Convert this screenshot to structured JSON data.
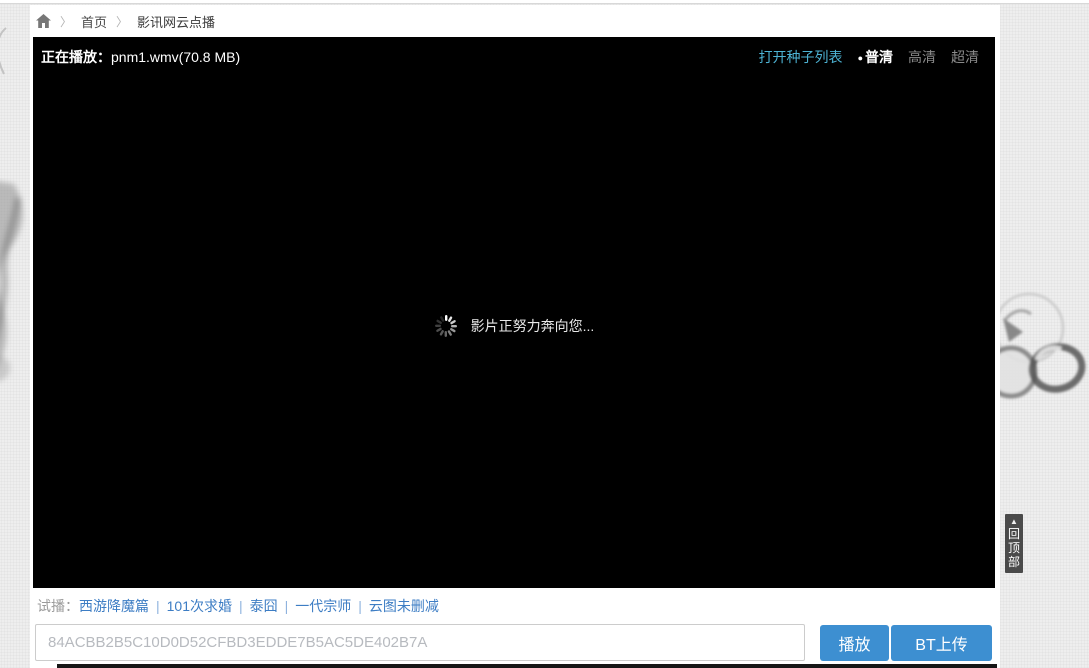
{
  "breadcrumb": {
    "separator": "〉",
    "items": [
      {
        "label": "首页"
      },
      {
        "label": "影讯网云点播"
      }
    ]
  },
  "player": {
    "now_playing_label": "正在播放：",
    "filename": "pnm1.wmv(70.8 MB)",
    "torrent_list_link": "打开种子列表",
    "selected_marker": "●",
    "quality_options": [
      {
        "label": "普清",
        "selected": true
      },
      {
        "label": "高清",
        "selected": false
      },
      {
        "label": "超清",
        "selected": false
      }
    ],
    "loading_text": "影片正努力奔向您..."
  },
  "trial": {
    "label": "试播：",
    "separator": "|",
    "links": [
      "西游降魔篇",
      "101次求婚",
      "泰囧",
      "一代宗师",
      "云图未删减"
    ]
  },
  "hash_input": {
    "placeholder": "84ACBB2B5C10D0D52CFBD3EDDE7B5AC5DE402B7A"
  },
  "actions": {
    "play_label": "播放",
    "bt_upload_label": "BT上传"
  },
  "back_to_top": {
    "arrow": "▲",
    "label": "回顶部"
  },
  "colors": {
    "accent_button": "#3d8fd1",
    "trial_link": "#3d7dc4",
    "player_link": "#4db3d4",
    "quality_inactive": "#8a8a8a",
    "player_bg": "#000000"
  }
}
